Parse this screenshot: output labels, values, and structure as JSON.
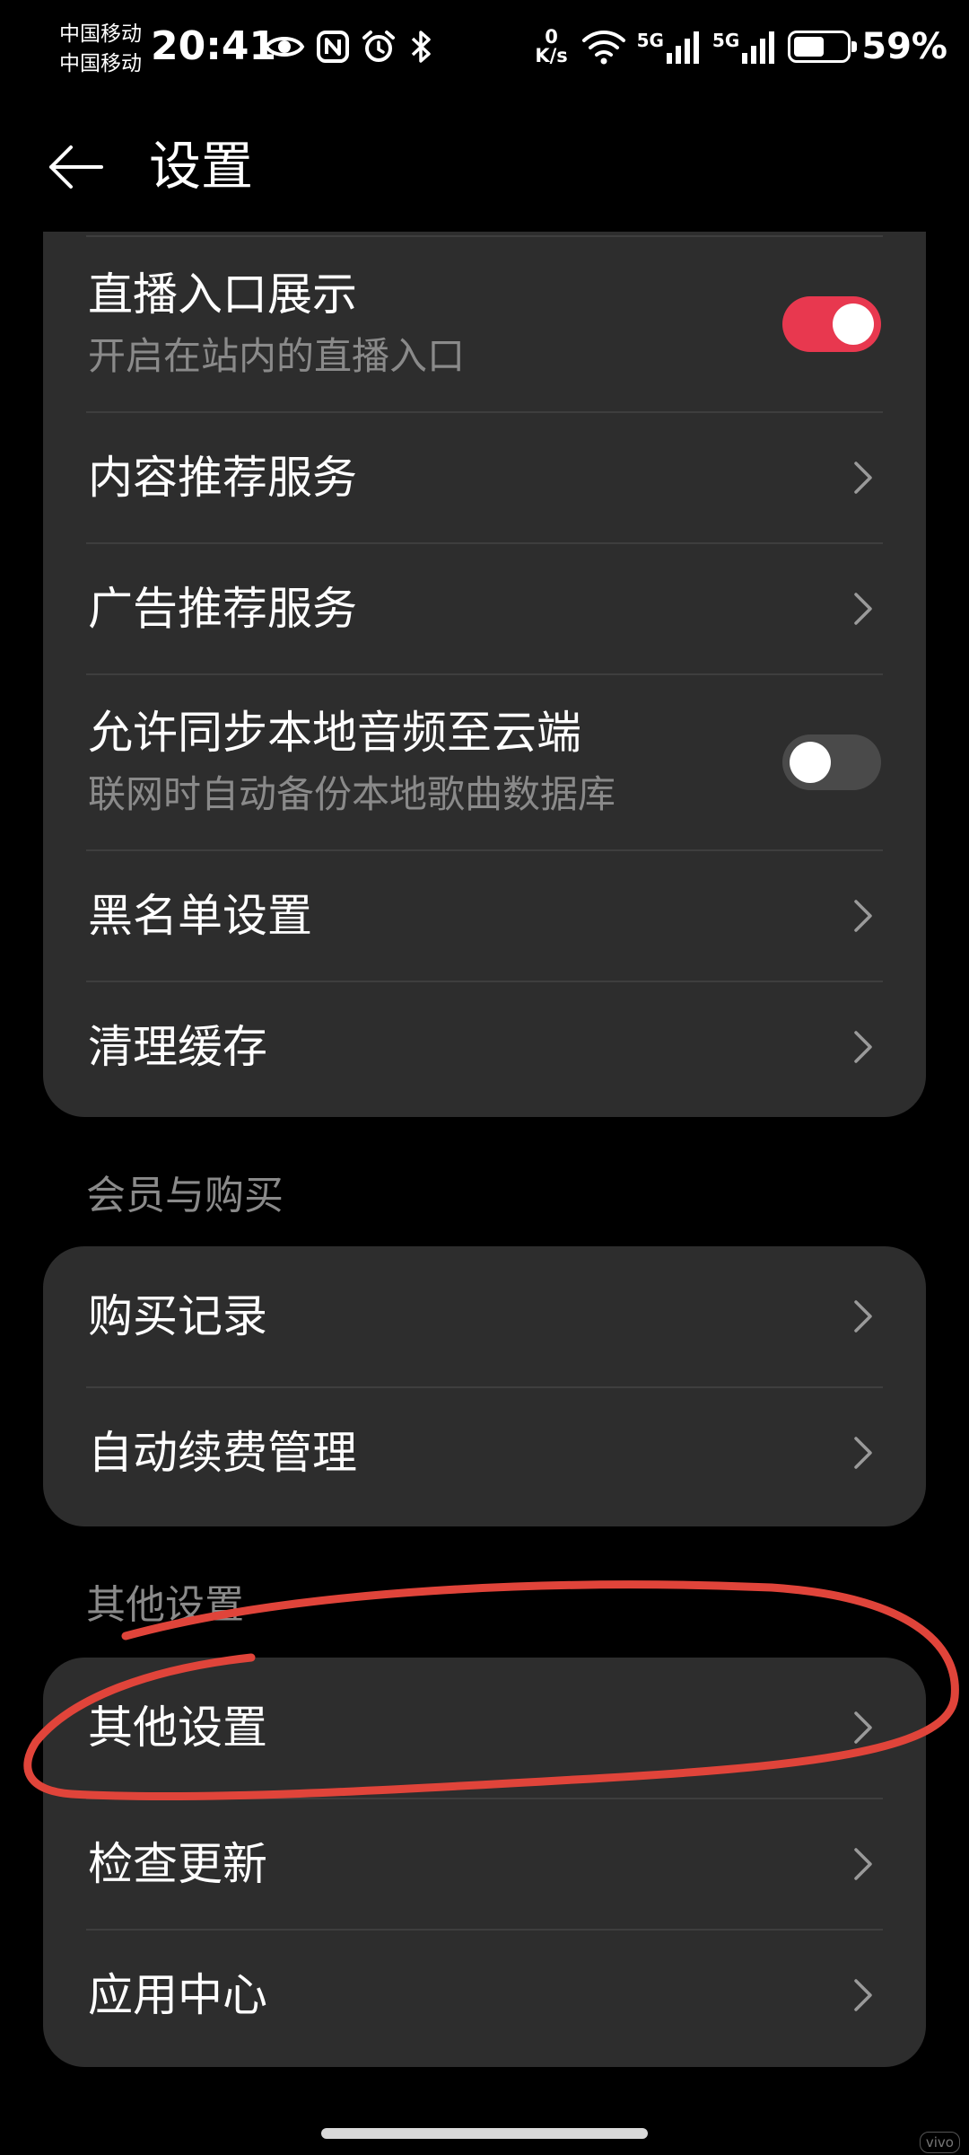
{
  "status_bar": {
    "carrier_1": "中国移动",
    "carrier_2": "中国移动",
    "time": "20:41",
    "net_speed_value": "0",
    "net_speed_unit": "K/s",
    "signal_1_label": "5G",
    "signal_2_label": "5G",
    "battery_level": 0.59,
    "battery_percent": "59%",
    "icons_left": [
      "eye-icon",
      "nfc-icon",
      "alarm-icon",
      "bluetooth-icon"
    ],
    "icons_right": [
      "wifi-icon",
      "signal-icon",
      "signal-icon",
      "battery-icon"
    ]
  },
  "app_bar": {
    "back_icon": "arrow-left-icon",
    "title": "设置"
  },
  "sections": {
    "general": {
      "items": [
        {
          "title": "直播入口展示",
          "subtitle": "开启在站内的直播入口",
          "control": "toggle",
          "on": true
        },
        {
          "title": "内容推荐服务",
          "control": "chevron"
        },
        {
          "title": "广告推荐服务",
          "control": "chevron"
        },
        {
          "title": "允许同步本地音频至云端",
          "subtitle": "联网时自动备份本地歌曲数据库",
          "control": "toggle",
          "on": false
        },
        {
          "title": "黑名单设置",
          "control": "chevron"
        },
        {
          "title": "清理缓存",
          "control": "chevron"
        }
      ]
    },
    "membership": {
      "header": "会员与购买",
      "items": [
        {
          "title": "购买记录",
          "control": "chevron"
        },
        {
          "title": "自动续费管理",
          "control": "chevron"
        }
      ]
    },
    "other": {
      "header": "其他设置",
      "items": [
        {
          "title": "其他设置",
          "control": "chevron"
        },
        {
          "title": "检查更新",
          "control": "chevron"
        },
        {
          "title": "应用中心",
          "control": "chevron"
        }
      ]
    }
  },
  "colors": {
    "background": "#000000",
    "card": "#2d2d2d",
    "toggle_on": "#e8384f",
    "toggle_off": "#4a4a4a",
    "secondary_text": "#8a8a8a",
    "annotation": "#e0443a"
  },
  "watermark": "vivo"
}
